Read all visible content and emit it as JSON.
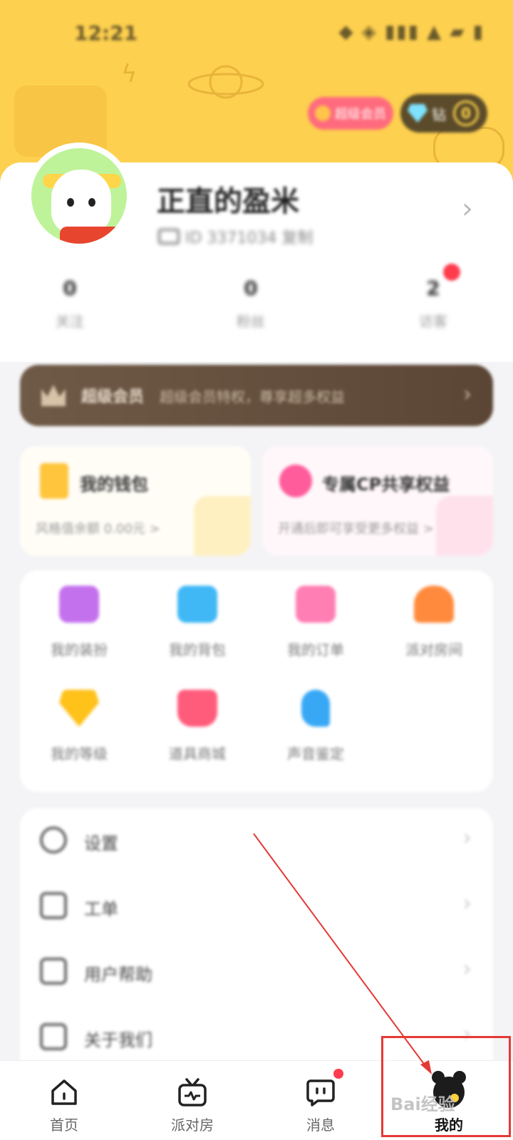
{
  "status_bar": {
    "time": "12:21",
    "icons": "◆ ◈ ▮▮▮ ▲ ▰ ▮"
  },
  "header": {
    "vip_pill": "超级会员",
    "gem_pill_label": "钻",
    "gem_count": "0"
  },
  "profile": {
    "nickname": "正直的盈米",
    "user_id": "ID 3371034 复制"
  },
  "stats": [
    {
      "value": "0",
      "label": "关注"
    },
    {
      "value": "0",
      "label": "粉丝"
    },
    {
      "value": "2",
      "label": "访客"
    }
  ],
  "vip_banner": {
    "title": "超级会员",
    "subtitle": "超级会员特权，尊享超多权益"
  },
  "cards": [
    {
      "title": "我的钱包",
      "subtitle": "风格值余额 0.00元 >"
    },
    {
      "title": "专属CP共享权益",
      "subtitle": "开通后即可享受更多权益 >"
    }
  ],
  "grid": [
    {
      "label": "我的装扮",
      "color": "#c471ed"
    },
    {
      "label": "我的背包",
      "color": "#3fb8f5"
    },
    {
      "label": "我的订单",
      "color": "#ff7eb3"
    },
    {
      "label": "派对房间",
      "color": "#ff8a3d"
    },
    {
      "label": "我的等级",
      "color": "#ffc21a"
    },
    {
      "label": "道具商城",
      "color": "#ff5c7c"
    },
    {
      "label": "声音鉴定",
      "color": "#38a8f5"
    }
  ],
  "list": [
    {
      "label": "设置"
    },
    {
      "label": "工单"
    },
    {
      "label": "用户帮助"
    },
    {
      "label": "关于我们"
    }
  ],
  "tabs": [
    {
      "label": "首页"
    },
    {
      "label": "派对房"
    },
    {
      "label": "消息"
    },
    {
      "label": "我的"
    }
  ],
  "annotation_color": "#e53935",
  "watermark": "Bai经验"
}
